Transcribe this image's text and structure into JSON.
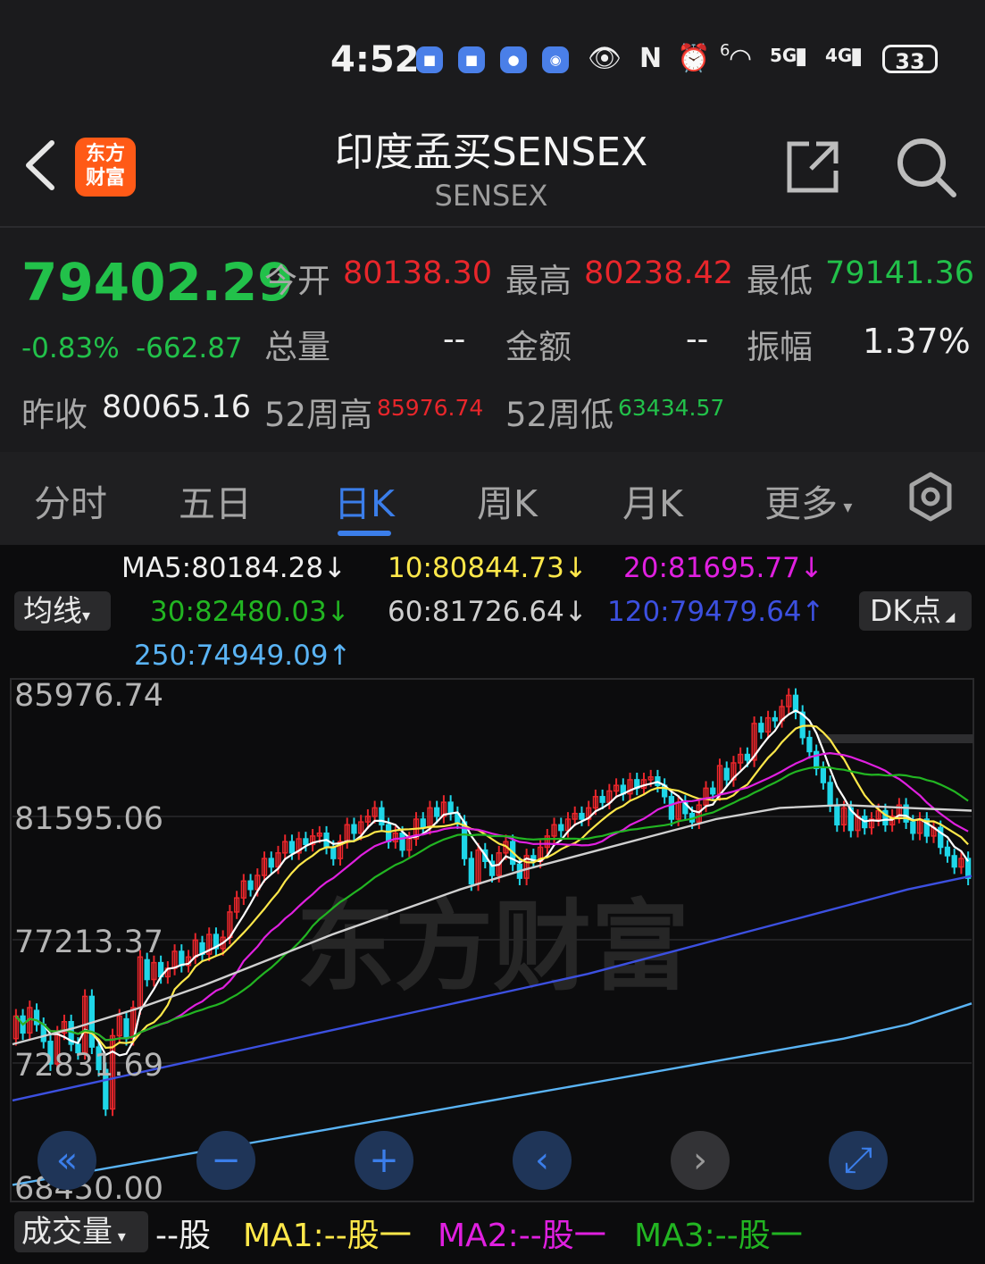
{
  "status": {
    "time": "4:52",
    "battery": "33",
    "net_5g": "5G",
    "net_4g": "4G",
    "wifi_sup": "6"
  },
  "header": {
    "title": "印度孟买SENSEX",
    "subtitle": "SENSEX",
    "logo_line1": "东方",
    "logo_line2": "财富"
  },
  "quote": {
    "price": "79402.29",
    "change_pct": "-0.83%",
    "change": "-662.87",
    "open_label": "今开",
    "open": "80138.30",
    "high_label": "最高",
    "high": "80238.42",
    "low_label": "最低",
    "low": "79141.36",
    "volume_label": "总量",
    "volume": "--",
    "amount_label": "金额",
    "amount": "--",
    "amplitude_label": "振幅",
    "amplitude": "1.37%",
    "prev_close_label": "昨收",
    "prev_close": "80065.16",
    "w52_high_label": "52周高",
    "w52_high": "85976.74",
    "w52_low_label": "52周低",
    "w52_low": "63434.57"
  },
  "tabs": [
    "分时",
    "五日",
    "日K",
    "周K",
    "月K",
    "更多"
  ],
  "active_tab": "日K",
  "ma_legend": {
    "ma5": "MA5:80184.28↓",
    "ma10": "10:80844.73↓",
    "ma20": "20:81695.77↓",
    "ma30": "30:82480.03↓",
    "ma60": "60:81726.64↓",
    "ma120": "120:79479.64↑",
    "ma250": "250:74949.09↑",
    "junxian_button": "均线",
    "dk_button": "DK点"
  },
  "colors": {
    "up": "#e8262b",
    "down": "#1fd6e8",
    "price_down": "#22c14a",
    "ma5": "#ffffff",
    "ma10": "#ffe84a",
    "ma20": "#e020e0",
    "ma30": "#22b522",
    "ma60": "#d0d0d0",
    "ma120": "#3c50e0",
    "ma250": "#5ab4f5",
    "accent": "#3b7eea"
  },
  "chart_data": {
    "type": "candlestick",
    "y_tick_labels": [
      "85976.74",
      "81595.06",
      "77213.37",
      "72831.69",
      "68450.00"
    ],
    "ylim": [
      68450.0,
      85976.74
    ],
    "watermark": "东方财富",
    "candles": [
      {
        "o": 73700,
        "c": 74500
      },
      {
        "o": 74500,
        "c": 73900
      },
      {
        "o": 73900,
        "c": 74800
      },
      {
        "o": 74700,
        "c": 74200
      },
      {
        "o": 74200,
        "c": 73600
      },
      {
        "o": 73600,
        "c": 72800
      },
      {
        "o": 72800,
        "c": 73900
      },
      {
        "o": 73900,
        "c": 74300
      },
      {
        "o": 74300,
        "c": 73500
      },
      {
        "o": 73500,
        "c": 73200
      },
      {
        "o": 73200,
        "c": 75200
      },
      {
        "o": 75200,
        "c": 73400
      },
      {
        "o": 73400,
        "c": 72600
      },
      {
        "o": 72600,
        "c": 71200
      },
      {
        "o": 71200,
        "c": 73800
      },
      {
        "o": 73800,
        "c": 74500
      },
      {
        "o": 74400,
        "c": 73700
      },
      {
        "o": 73700,
        "c": 74800
      },
      {
        "o": 74800,
        "c": 76600
      },
      {
        "o": 76500,
        "c": 75800
      },
      {
        "o": 75800,
        "c": 76400
      },
      {
        "o": 76400,
        "c": 75900
      },
      {
        "o": 75900,
        "c": 76200
      },
      {
        "o": 76200,
        "c": 76800
      },
      {
        "o": 76800,
        "c": 76300
      },
      {
        "o": 76300,
        "c": 76600
      },
      {
        "o": 76600,
        "c": 77200
      },
      {
        "o": 77100,
        "c": 76700
      },
      {
        "o": 76700,
        "c": 77400
      },
      {
        "o": 77400,
        "c": 76900
      },
      {
        "o": 76900,
        "c": 77300
      },
      {
        "o": 77300,
        "c": 78200
      },
      {
        "o": 78200,
        "c": 78700
      },
      {
        "o": 78700,
        "c": 79300
      },
      {
        "o": 79300,
        "c": 79000
      },
      {
        "o": 79000,
        "c": 79500
      },
      {
        "o": 79500,
        "c": 80100
      },
      {
        "o": 80100,
        "c": 79800
      },
      {
        "o": 79800,
        "c": 80300
      },
      {
        "o": 80300,
        "c": 80700
      },
      {
        "o": 80700,
        "c": 80300
      },
      {
        "o": 80300,
        "c": 80800
      },
      {
        "o": 80800,
        "c": 80600
      },
      {
        "o": 80600,
        "c": 80900
      },
      {
        "o": 80900,
        "c": 81000
      },
      {
        "o": 81000,
        "c": 80500
      },
      {
        "o": 80500,
        "c": 80100
      },
      {
        "o": 80100,
        "c": 80700
      },
      {
        "o": 80700,
        "c": 81300
      },
      {
        "o": 81300,
        "c": 81000
      },
      {
        "o": 81000,
        "c": 81400
      },
      {
        "o": 81400,
        "c": 81600
      },
      {
        "o": 81600,
        "c": 81900
      },
      {
        "o": 81900,
        "c": 81300
      },
      {
        "o": 81300,
        "c": 80700
      },
      {
        "o": 80700,
        "c": 81000
      },
      {
        "o": 81000,
        "c": 80400
      },
      {
        "o": 80400,
        "c": 80800
      },
      {
        "o": 80800,
        "c": 81500
      },
      {
        "o": 81500,
        "c": 81200
      },
      {
        "o": 81200,
        "c": 81900
      },
      {
        "o": 81900,
        "c": 81600
      },
      {
        "o": 81600,
        "c": 82100
      },
      {
        "o": 82100,
        "c": 81700
      },
      {
        "o": 81700,
        "c": 81400
      },
      {
        "o": 81400,
        "c": 80100
      },
      {
        "o": 80100,
        "c": 79200
      },
      {
        "o": 79200,
        "c": 80400
      },
      {
        "o": 80400,
        "c": 80000
      },
      {
        "o": 80000,
        "c": 79500
      },
      {
        "o": 79500,
        "c": 80300
      },
      {
        "o": 80300,
        "c": 80700
      },
      {
        "o": 80700,
        "c": 79900
      },
      {
        "o": 79900,
        "c": 79400
      },
      {
        "o": 79400,
        "c": 80200
      },
      {
        "o": 80200,
        "c": 80000
      },
      {
        "o": 80000,
        "c": 80500
      },
      {
        "o": 80500,
        "c": 80900
      },
      {
        "o": 80900,
        "c": 81300
      },
      {
        "o": 81300,
        "c": 81100
      },
      {
        "o": 81100,
        "c": 81500
      },
      {
        "o": 81500,
        "c": 81700
      },
      {
        "o": 81700,
        "c": 81500
      },
      {
        "o": 81500,
        "c": 81900
      },
      {
        "o": 81900,
        "c": 82300
      },
      {
        "o": 82300,
        "c": 82100
      },
      {
        "o": 82100,
        "c": 82500
      },
      {
        "o": 82500,
        "c": 82700
      },
      {
        "o": 82700,
        "c": 82400
      },
      {
        "o": 82400,
        "c": 82900
      },
      {
        "o": 82900,
        "c": 82600
      },
      {
        "o": 82600,
        "c": 82900
      },
      {
        "o": 82900,
        "c": 83000
      },
      {
        "o": 83000,
        "c": 82700
      },
      {
        "o": 82700,
        "c": 82300
      },
      {
        "o": 82300,
        "c": 81500
      },
      {
        "o": 81500,
        "c": 82100
      },
      {
        "o": 82100,
        "c": 81700
      },
      {
        "o": 81700,
        "c": 81400
      },
      {
        "o": 81400,
        "c": 82000
      },
      {
        "o": 82000,
        "c": 82600
      },
      {
        "o": 82600,
        "c": 82400
      },
      {
        "o": 82400,
        "c": 83400
      },
      {
        "o": 83300,
        "c": 82900
      },
      {
        "o": 82900,
        "c": 83500
      },
      {
        "o": 83500,
        "c": 83800
      },
      {
        "o": 83800,
        "c": 83600
      },
      {
        "o": 83600,
        "c": 84900
      },
      {
        "o": 84900,
        "c": 84600
      },
      {
        "o": 84600,
        "c": 85100
      },
      {
        "o": 85100,
        "c": 85000
      },
      {
        "o": 85000,
        "c": 85500
      },
      {
        "o": 85500,
        "c": 85900
      },
      {
        "o": 85900,
        "c": 85300
      },
      {
        "o": 85300,
        "c": 84400
      },
      {
        "o": 84400,
        "c": 83900
      },
      {
        "o": 83900,
        "c": 83300
      },
      {
        "o": 83300,
        "c": 82800
      },
      {
        "o": 82800,
        "c": 82000
      },
      {
        "o": 82000,
        "c": 81300
      },
      {
        "o": 81300,
        "c": 81900
      },
      {
        "o": 81900,
        "c": 81100
      },
      {
        "o": 81100,
        "c": 81600
      },
      {
        "o": 81600,
        "c": 81200
      },
      {
        "o": 81200,
        "c": 81500
      },
      {
        "o": 81500,
        "c": 81800
      },
      {
        "o": 81800,
        "c": 81300
      },
      {
        "o": 81300,
        "c": 81600
      },
      {
        "o": 81600,
        "c": 82000
      },
      {
        "o": 82000,
        "c": 81400
      },
      {
        "o": 81400,
        "c": 81000
      },
      {
        "o": 81000,
        "c": 81500
      },
      {
        "o": 81500,
        "c": 80900
      },
      {
        "o": 80900,
        "c": 81200
      },
      {
        "o": 81200,
        "c": 80500
      },
      {
        "o": 80500,
        "c": 80200
      },
      {
        "o": 80200,
        "c": 79800
      },
      {
        "o": 79800,
        "c": 80100
      },
      {
        "o": 80100,
        "c": 79400
      }
    ],
    "ma_lines": {
      "ma60": [
        73500,
        74100,
        74800,
        75600,
        76500,
        77400,
        78200,
        79000,
        79700,
        80300,
        80900,
        81500,
        81900,
        82000,
        81900,
        81800
      ],
      "ma120": [
        71500,
        72000,
        72500,
        73000,
        73500,
        74000,
        74500,
        75000,
        75500,
        76000,
        76600,
        77200,
        77800,
        78400,
        79000,
        79480
      ],
      "ma250": [
        68500,
        68900,
        69300,
        69700,
        70100,
        70500,
        70900,
        71300,
        71700,
        72100,
        72500,
        72900,
        73300,
        73700,
        74200,
        74950
      ]
    }
  },
  "nav": {
    "first": "«",
    "zoom_out": "−",
    "zoom_in": "+",
    "prev": "‹",
    "next": "›",
    "fullscreen": "⤢"
  },
  "volume": {
    "label": "成交量",
    "unit": "--股",
    "ma1": "MA1:--股一",
    "ma2": "MA2:--股一",
    "ma3": "MA3:--股一"
  }
}
